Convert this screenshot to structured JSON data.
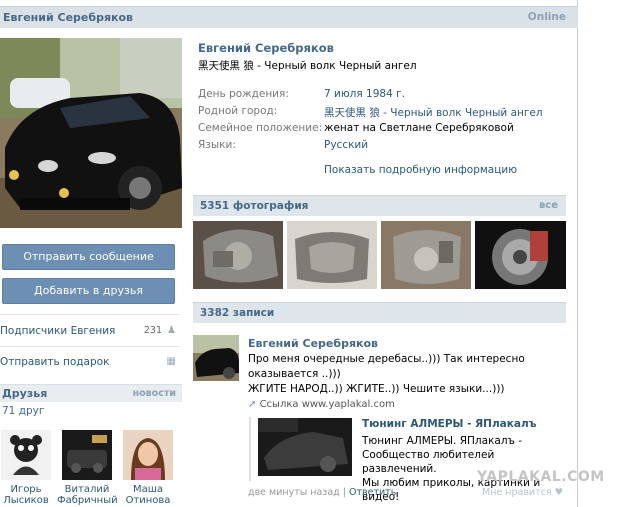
{
  "profile": {
    "name": "Евгений Серебряков",
    "online": "Online",
    "status": "黑天使黒 狼 - Черный волк Черный ангел"
  },
  "actions": {
    "message": "Отправить сообщение",
    "add_friend": "Добавить в друзья"
  },
  "sidebar": {
    "followers_label": "Подписчики Евгения",
    "followers_count": "231",
    "gift_label": "Отправить подарок"
  },
  "friends": {
    "title": "Друзья",
    "news": "новости",
    "count": "71 друг",
    "items": [
      {
        "first": "Игорь",
        "last": "Лысиков"
      },
      {
        "first": "Виталий",
        "last": "Фабричный"
      },
      {
        "first": "Маша",
        "last": "Отинова"
      }
    ]
  },
  "info": {
    "birthday_label": "День рождения:",
    "birthday_value": "7 июля 1984 г.",
    "hometown_label": "Родной город:",
    "hometown_value": "黑天使黒 狼 - Черный волк Черный ангел",
    "family_label": "Семейное положение:",
    "family_value": "женат на Светлане Серебряковой",
    "lang_label": "Языки:",
    "lang_value": "Русский",
    "more": "Показать подробную информацию"
  },
  "photos": {
    "title": "5351 фотография",
    "all": "все"
  },
  "wall": {
    "title": "3382 записи",
    "post": {
      "author": "Евгений Серебряков",
      "line1": "Про меня очередные деребасы..))) Так интересно",
      "line2": "оказывается ..)))",
      "line3": "ЖГИТЕ НАРОД..)) ЖГИТЕ..)) Чешите языки...)))",
      "link": "Ссылка www.yaplakal.com",
      "repost_title": "Тюнинг АЛМЕРЫ - ЯПлакалъ",
      "repost_line1": "Тюнинг АЛМЕРЫ. ЯПлакалъ -",
      "repost_line2": "Сообщество любителей развлечений.",
      "repost_line3": "Мы любим приколы, картинки и видео!",
      "time": "две минуты назад",
      "sep": "|",
      "reply": "Ответить",
      "like": "Мне нравится"
    }
  },
  "watermark": "YAPLAKAL.COM",
  "colors": {
    "link": "#2b587a",
    "header_bg": "#dae2e8",
    "button": "#6d8fb3"
  }
}
